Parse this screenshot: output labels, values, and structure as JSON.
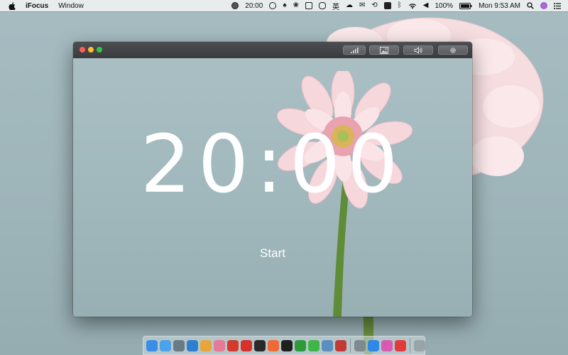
{
  "menubar": {
    "app_name": "iFocus",
    "menus": [
      "Window"
    ],
    "timer_status": "20:00",
    "battery": "100%",
    "clock": "Mon 9:53 AM",
    "input_method": "英",
    "status_icons": [
      "timer-status-icon",
      "upload-icon",
      "tree-icon",
      "evernote-icon",
      "screen-icon",
      "browser-icon",
      "wechat-icon",
      "time-machine-icon",
      "bluetooth-icon",
      "wifi-icon",
      "volume-icon",
      "battery-icon",
      "search-icon",
      "siri-icon",
      "notification-center-icon"
    ]
  },
  "window": {
    "timer": "20:00",
    "start_label": "Start",
    "toolbar": [
      "stats-icon",
      "image-icon",
      "sound-icon",
      "settings-icon"
    ]
  },
  "dock": {
    "apps": [
      {
        "name": "finder-icon",
        "color": "#3a8ee6"
      },
      {
        "name": "launchpad-icon",
        "color": "#4da3e8"
      },
      {
        "name": "downloads-icon",
        "color": "#6b7b86"
      },
      {
        "name": "xcode-icon",
        "color": "#2e7fd0"
      },
      {
        "name": "chrome-icon",
        "color": "#e8a53a"
      },
      {
        "name": "photos-icon",
        "color": "#e57a9a"
      },
      {
        "name": "netease-music-icon",
        "color": "#d33a2c"
      },
      {
        "name": "app-red-icon",
        "color": "#d9312a"
      },
      {
        "name": "qq-icon",
        "color": "#2a2a2a"
      },
      {
        "name": "swift-icon",
        "color": "#f06a35"
      },
      {
        "name": "terminal-icon",
        "color": "#1f1f1f"
      },
      {
        "name": "evernote-icon",
        "color": "#2f9a3a"
      },
      {
        "name": "wechat-icon",
        "color": "#3fb54a"
      },
      {
        "name": "preview-icon",
        "color": "#5b8fbf"
      },
      {
        "name": "wps-icon",
        "color": "#c23b34"
      },
      {
        "name": "system-preferences-icon",
        "color": "#808890"
      },
      {
        "name": "app-store-icon",
        "color": "#2f88e6"
      },
      {
        "name": "itunes-icon",
        "color": "#d85ab3"
      },
      {
        "name": "todo-icon",
        "color": "#e23b3b"
      },
      {
        "name": "trash-icon",
        "color": "#9aa3a8"
      }
    ]
  }
}
